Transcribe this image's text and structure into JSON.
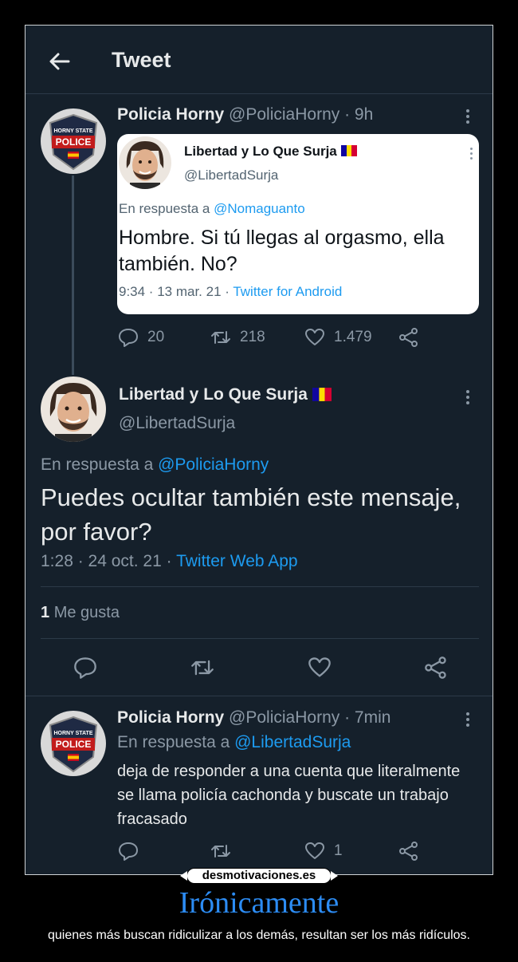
{
  "header": {
    "title": "Tweet"
  },
  "tweet1": {
    "name": "Policia Horny",
    "handle": "@PoliciaHorny",
    "time": "· 9h",
    "avatar_text": "HORNY STATE",
    "avatar_badge": "POLICE",
    "embedded": {
      "name": "Libertad y Lo Que Surja",
      "handle": "@LibertadSurja",
      "reply_prefix": "En respuesta a",
      "reply_to": "@Nomaguanto",
      "text": "Hombre. Si tú llegas al orgasmo, ella también. No?",
      "date": "9:34 · 13 mar. 21 ·",
      "source": "Twitter for Android"
    },
    "replies": "20",
    "retweets": "218",
    "likes": "1.479"
  },
  "tweet2": {
    "name": "Libertad y Lo Que Surja",
    "handle": "@LibertadSurja",
    "reply_prefix": "En respuesta a",
    "reply_to": "@PoliciaHorny",
    "text": "Puedes ocultar también este mensaje, por favor?",
    "date": "1:28 · 24 oct. 21 ·",
    "source": "Twitter Web App",
    "likes_count": "1",
    "likes_label": "Me gusta"
  },
  "tweet3": {
    "name": "Policia Horny",
    "handle": "@PoliciaHorny",
    "time": "· 7min",
    "reply_prefix": "En respuesta a",
    "reply_to": "@LibertadSurja",
    "text": "deja de responder a una cuenta que literalmente se llama policía cachonda y buscate un trabajo fracasado",
    "likes": "1"
  },
  "footer": {
    "site": "desmotivaciones.es",
    "title": "Irónicamente",
    "subtitle": "quienes más buscan ridiculizar a los demás, resultan ser los más ridículos."
  },
  "colors": {
    "background": "#15202b",
    "link": "#1d9bf0",
    "muted": "#8b98a5",
    "caption": "#2c8cf4"
  },
  "icons": [
    "back-arrow-icon",
    "more-icon",
    "reply-icon",
    "retweet-icon",
    "like-icon",
    "share-icon",
    "flag-icon"
  ]
}
